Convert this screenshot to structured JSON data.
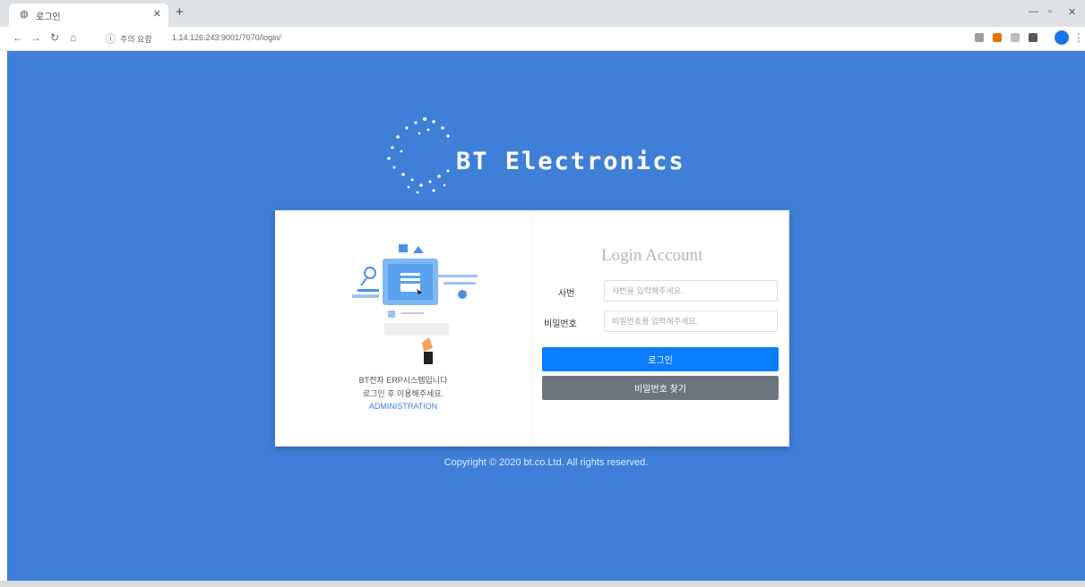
{
  "browser": {
    "tab_title": "로그인",
    "url_label": "주의 요함",
    "url": "1.14.126.243:9001/7070/login/",
    "colors": {
      "chrome": "#dee1e6",
      "avatar": "#1a73e8"
    }
  },
  "brand": {
    "name": "BT Electronics"
  },
  "intro": {
    "line1": "BT전자 ERP시스템입니다",
    "line2": "로그인 후 이용해주세요.",
    "link": "ADMINISTRATION"
  },
  "login": {
    "title": "Login Account",
    "id_label": "사번",
    "id_placeholder": "사번을 입력해주세요.",
    "password_label": "비밀번호",
    "password_placeholder": "비밀번호를 입력해주세요.",
    "login_button": "로그인",
    "find_password_button": "비밀번호 찾기"
  },
  "footer": {
    "copyright": "Copyright © 2020 bt.co.Ltd. All rights reserved."
  },
  "colors": {
    "page_background": "#3f7fd7",
    "primary_button": "#0a7dfc",
    "secondary_button": "#6c757d"
  }
}
